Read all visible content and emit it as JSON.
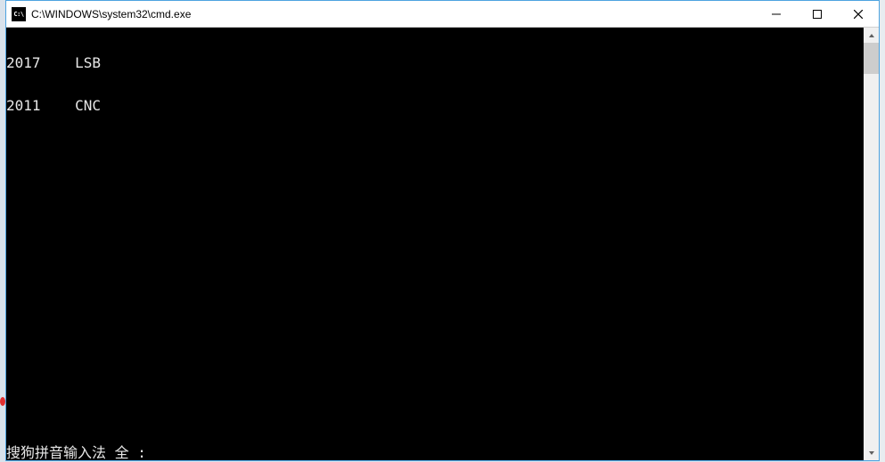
{
  "window": {
    "icon_text": "C:\\",
    "title": "C:\\WINDOWS\\system32\\cmd.exe"
  },
  "console": {
    "lines": [
      "2017    LSB",
      "2011    CNC"
    ],
    "ime_status": "搜狗拼音输入法 全 :"
  }
}
